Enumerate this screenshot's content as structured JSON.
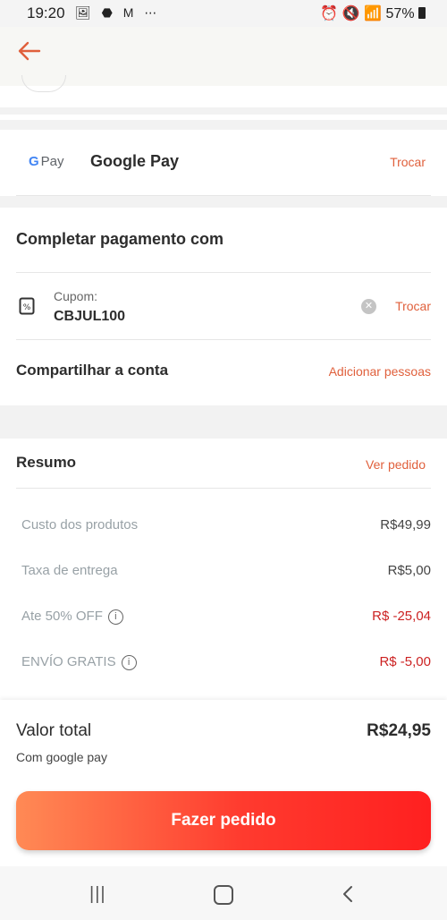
{
  "status_bar": {
    "time": "19:20",
    "left_icons": "🖼 ⬣ M ⋯",
    "battery": "57%"
  },
  "payment_method": {
    "logo_text": "G Pay",
    "name": "Google Pay",
    "change_label": "Trocar"
  },
  "complete_payment": {
    "title": "Completar pagamento com",
    "coupon_label": "Cupom:",
    "coupon_code": "CBJUL100",
    "coupon_change_label": "Trocar",
    "share_label": "Compartilhar a conta",
    "add_people_label": "Adicionar pessoas"
  },
  "summary": {
    "title": "Resumo",
    "view_order_label": "Ver pedido",
    "rows": [
      {
        "label": "Custo dos produtos",
        "value": "R$49,99",
        "info": false,
        "discount": false
      },
      {
        "label": "Taxa de entrega",
        "value": "R$5,00",
        "info": false,
        "discount": false
      },
      {
        "label": "Ate 50% OFF",
        "value": "R$ -25,04",
        "info": true,
        "discount": true
      },
      {
        "label": "ENVÍO GRATIS",
        "value": "R$ -5,00",
        "info": true,
        "discount": true
      }
    ]
  },
  "total": {
    "label": "Valor total",
    "value": "R$24,95",
    "sub": "Com google pay"
  },
  "cta": {
    "label": "Fazer pedido"
  },
  "colors": {
    "accent": "#e0603c",
    "discount": "#cc2222",
    "cta_start": "#ff8a55",
    "cta_end": "#ff2020"
  }
}
